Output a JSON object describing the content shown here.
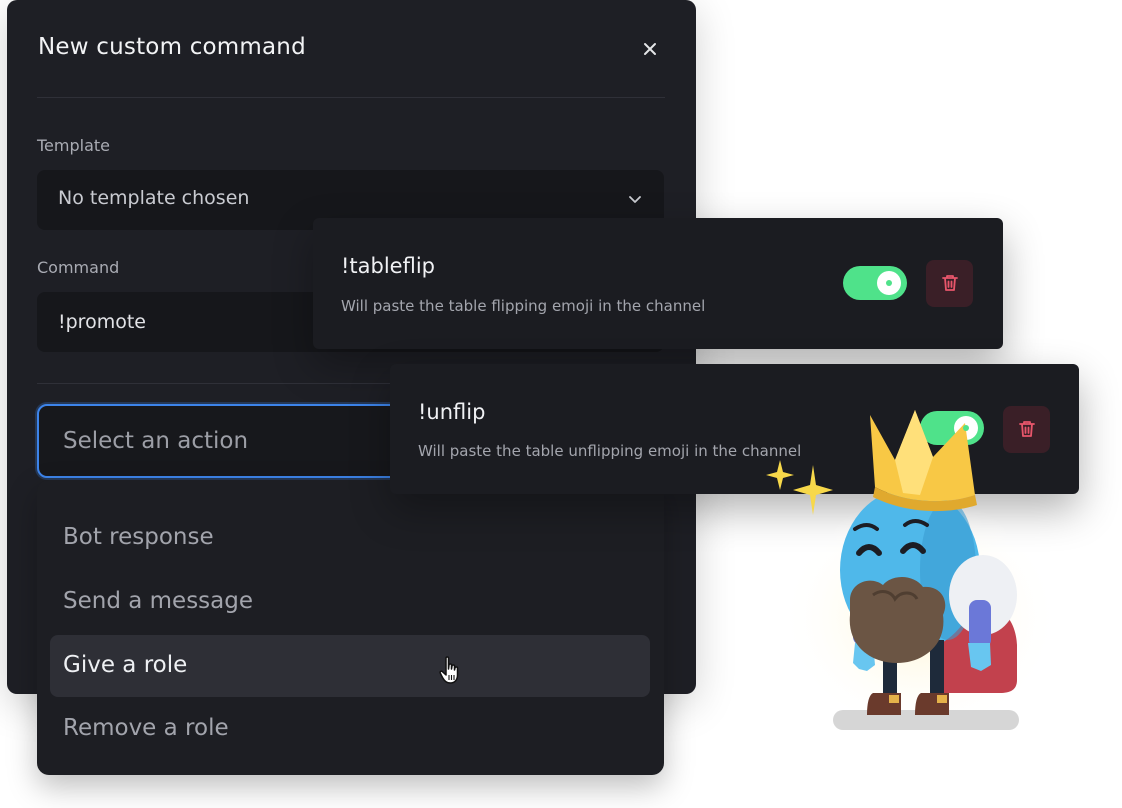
{
  "modal": {
    "title": "New custom command",
    "close_icon": "close-icon",
    "template": {
      "label": "Template",
      "value": "No template chosen"
    },
    "command": {
      "label": "Command",
      "value": "!promote"
    },
    "action": {
      "placeholder": "Select an action",
      "options": [
        "Bot response",
        "Send a message",
        "Give a role",
        "Remove a role"
      ],
      "highlighted": "Give a role"
    }
  },
  "commands": [
    {
      "name": "!tableflip",
      "description": "Will paste the table flipping emoji in the channel",
      "enabled": true
    },
    {
      "name": "!unflip",
      "description": "Will paste the table unflipping emoji in the channel",
      "enabled": true
    }
  ],
  "colors": {
    "accent_blue": "#3d84ea",
    "toggle_on": "#4fe28a",
    "danger": "#e8566b",
    "panel": "#1e1f25"
  }
}
